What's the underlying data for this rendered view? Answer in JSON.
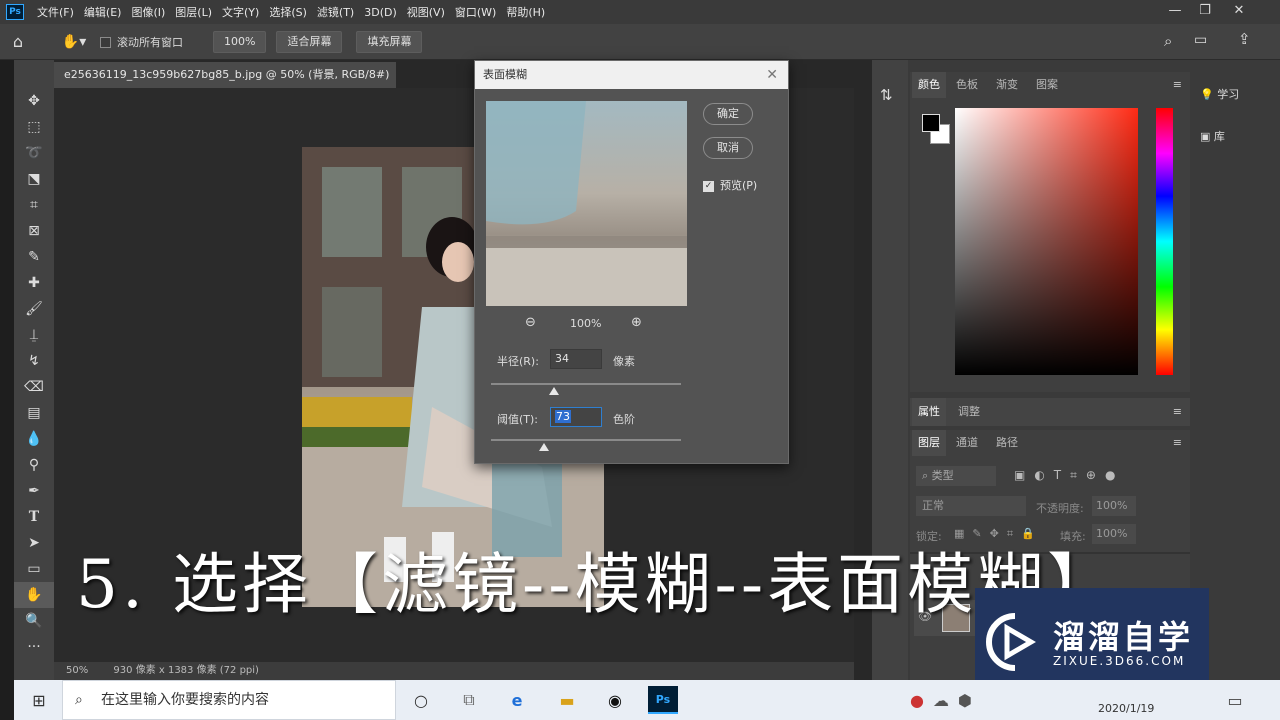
{
  "menubar": {
    "logo": "Ps",
    "items": [
      "文件(F)",
      "编辑(E)",
      "图像(I)",
      "图层(L)",
      "文字(Y)",
      "选择(S)",
      "滤镜(T)",
      "3D(D)",
      "视图(V)",
      "窗口(W)",
      "帮助(H)"
    ]
  },
  "optionsbar": {
    "scroll_all": "滚动所有窗口",
    "zoom_100": "100%",
    "fit_screen": "适合屏幕",
    "fill_screen": "填充屏幕"
  },
  "document": {
    "tab_title": "e25636119_13c959b627bg85_b.jpg @ 50% (背景, RGB/8#) *",
    "status_zoom": "50%",
    "status_info": "930 像素 x 1383 像素 (72 ppi)"
  },
  "dialog": {
    "title": "表面模糊",
    "ok": "确定",
    "cancel": "取消",
    "preview_label": "预览(P)",
    "preview_checked": true,
    "zoom": "100%",
    "radius_label": "半径(R):",
    "radius_value": "34",
    "radius_unit": "像素",
    "radius_slider_fraction": 0.33,
    "threshold_label": "阈值(T):",
    "threshold_value": "73",
    "threshold_unit": "色阶",
    "threshold_slider_fraction": 0.28
  },
  "panels": {
    "color_tabs": [
      "颜色",
      "色板",
      "渐变",
      "图案"
    ],
    "props_tabs": [
      "属性",
      "调整"
    ],
    "layer_tabs": [
      "图层",
      "通道",
      "路径"
    ],
    "layer_search": "类型",
    "blend_mode": "正常",
    "opacity_label": "不透明度:",
    "opacity_value": "100%",
    "lock_label": "锁定:",
    "fill_label": "填充:",
    "fill_value": "100%",
    "learn": "学习",
    "library": "库"
  },
  "subtitle": "5. 选择【滤镜--模糊--表面模糊】",
  "watermark": {
    "brand": "溜溜自学",
    "url": "ZIXUE.3D66.COM"
  },
  "taskbar": {
    "search_placeholder": "在这里输入你要搜索的内容",
    "date": "2020/1/19"
  },
  "colors": {
    "accent": "#31a8ff",
    "watermark_bg": "#22355f"
  }
}
